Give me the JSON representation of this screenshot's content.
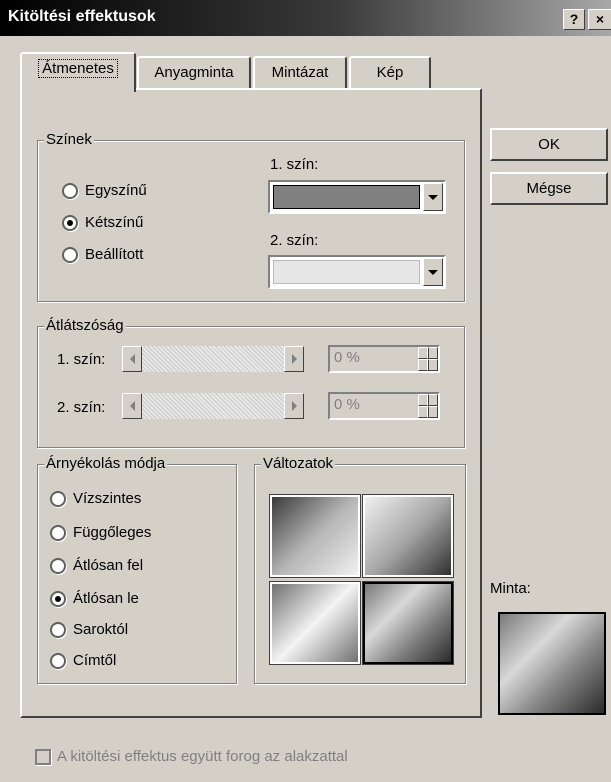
{
  "window": {
    "title": "Kitöltési effektusok",
    "help_label": "?",
    "close_label": "×"
  },
  "tabs": [
    {
      "label": "Átmenetes",
      "active": true
    },
    {
      "label": "Anyagminta",
      "active": false
    },
    {
      "label": "Mintázat",
      "active": false
    },
    {
      "label": "Kép",
      "active": false
    }
  ],
  "colors_group": {
    "legend": "Színek",
    "options": [
      {
        "label": "Egyszínű",
        "checked": false
      },
      {
        "label": "Kétszínű",
        "checked": true
      },
      {
        "label": "Beállított",
        "checked": false
      }
    ],
    "color1_label": "1. szín:",
    "color1_value": "#808080",
    "color2_label": "2. szín:",
    "color2_value": "#e6e6e6"
  },
  "transparency_group": {
    "legend": "Átlátszóság",
    "from_label": "1. szín:",
    "from_value": "0 %",
    "to_label": "2. szín:",
    "to_value": "0 %"
  },
  "shading_group": {
    "legend": "Árnyékolás módja",
    "options": [
      {
        "label": "Vízszintes",
        "checked": false
      },
      {
        "label": "Függőleges",
        "checked": false
      },
      {
        "label": "Átlósan fel",
        "checked": false
      },
      {
        "label": "Átlósan le",
        "checked": true
      },
      {
        "label": "Saroktól",
        "checked": false
      },
      {
        "label": "Címtől",
        "checked": false
      }
    ]
  },
  "variants_group": {
    "legend": "Változatok",
    "selected_index": 3
  },
  "buttons": {
    "ok_label": "OK",
    "cancel_label": "Mégse"
  },
  "sample": {
    "label": "Minta:"
  },
  "rotate_checkbox": {
    "label": "A kitöltési effektus együtt forog az alakzattal",
    "checked": false,
    "enabled": false
  }
}
